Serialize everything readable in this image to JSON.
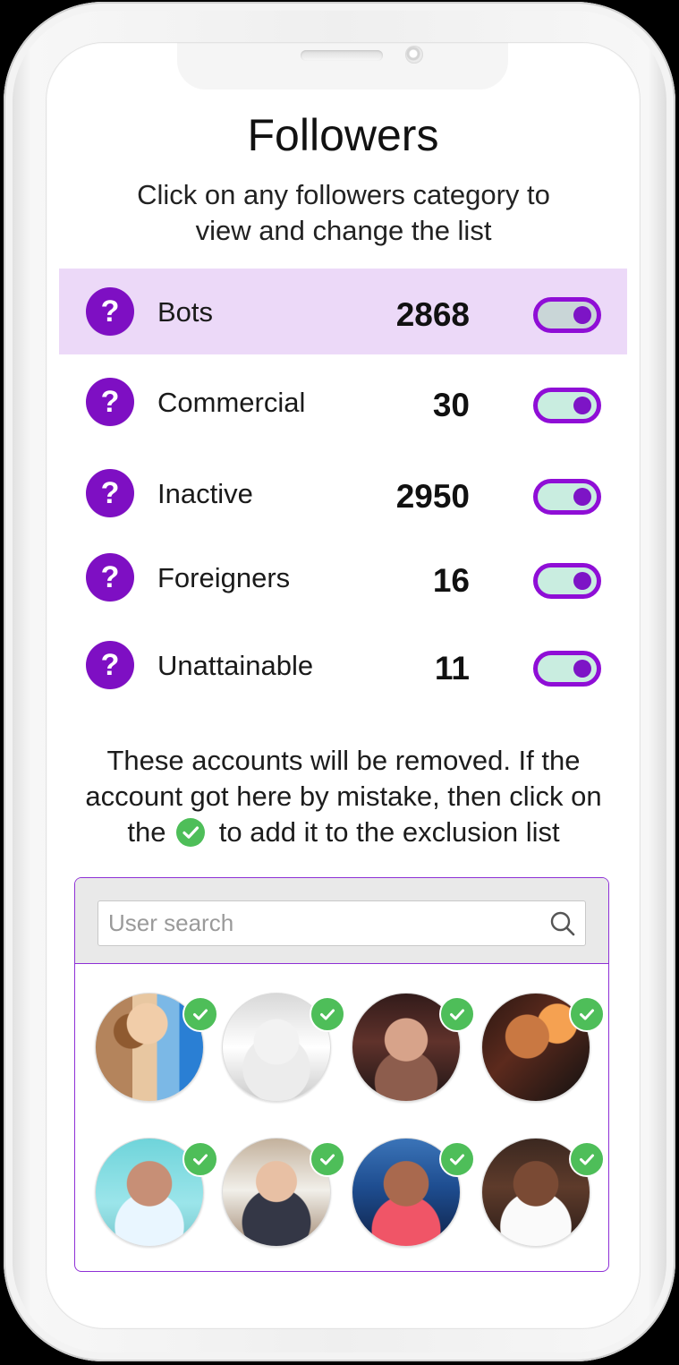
{
  "page": {
    "title": "Followers",
    "subtitle": "Click on any followers category to view and change the list",
    "notice": {
      "prefix": "These accounts will be removed. If the account got here by mistake, then click on the",
      "suffix": "to add it to the exclusion list"
    }
  },
  "colors": {
    "primary": "#7e0fc3",
    "selected_row": "#ecd9f8",
    "toggle_border": "#8f0ed6",
    "toggle_track": "#c9ede0",
    "check_green": "#4ebe59",
    "panel_border": "#8e30d6",
    "search_bg": "#e9e9e9"
  },
  "categories": [
    {
      "label": "Bots",
      "count": "2868",
      "selected": true,
      "enabled": true
    },
    {
      "label": "Commercial",
      "count": "30",
      "selected": false,
      "enabled": true
    },
    {
      "label": "Inactive",
      "count": "2950",
      "selected": false,
      "enabled": true
    },
    {
      "label": "Foreigners",
      "count": "16",
      "selected": false,
      "enabled": true
    },
    {
      "label": "Unattainable",
      "count": "11",
      "selected": false,
      "enabled": true
    }
  ],
  "search": {
    "placeholder": "User search",
    "value": ""
  },
  "icons": {
    "help": "question-mark-icon",
    "search": "search-icon",
    "check": "check-icon"
  },
  "help_symbol": "?",
  "users": [
    {
      "checked": true
    },
    {
      "checked": true
    },
    {
      "checked": true
    },
    {
      "checked": true
    },
    {
      "checked": true
    },
    {
      "checked": true
    },
    {
      "checked": true
    },
    {
      "checked": true
    }
  ]
}
